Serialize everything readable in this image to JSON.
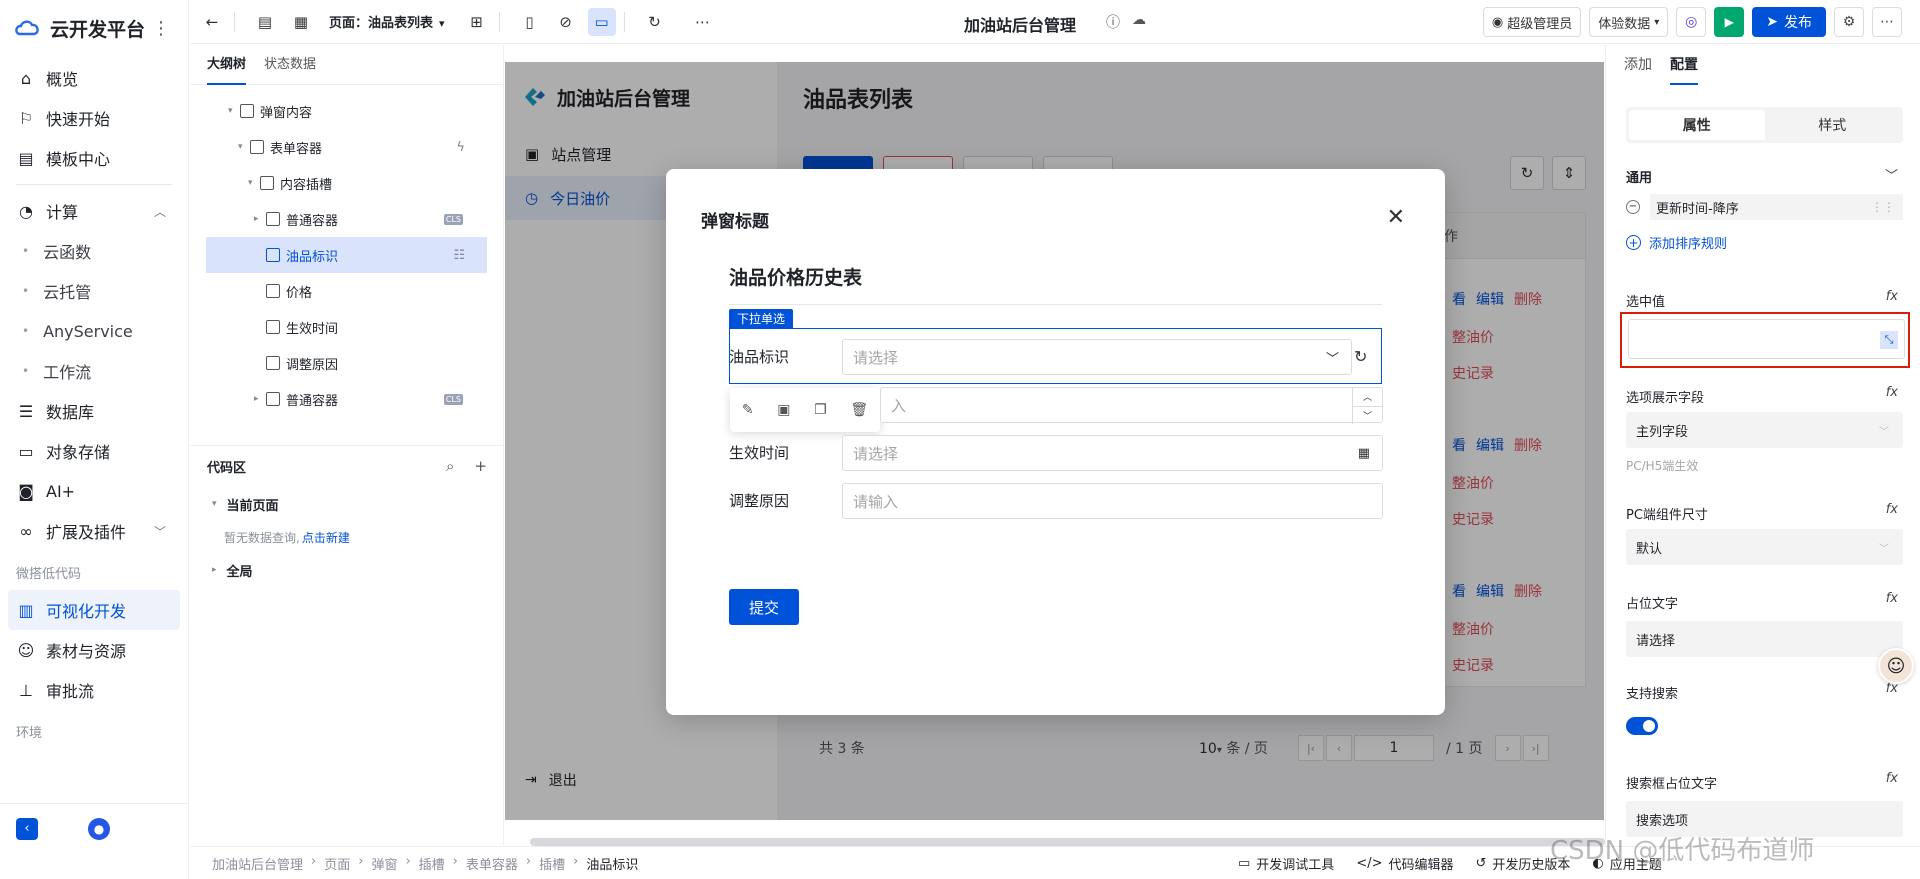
{
  "brand": {
    "title": "云开发平台"
  },
  "leftnav": {
    "items": [
      {
        "label": "概览"
      },
      {
        "label": "快速开始"
      },
      {
        "label": "模板中心"
      }
    ],
    "compute": {
      "label": "计算",
      "children": [
        "云函数",
        "云托管",
        "AnyService",
        "工作流"
      ]
    },
    "items2": [
      {
        "label": "数据库"
      },
      {
        "label": "对象存储"
      },
      {
        "label": "AI+"
      },
      {
        "label": "扩展及插件"
      }
    ],
    "group_lowcode": "微搭低代码",
    "items3": [
      {
        "label": "可视化开发"
      },
      {
        "label": "素材与资源"
      },
      {
        "label": "审批流"
      }
    ],
    "group_env": "环境"
  },
  "topbar": {
    "page_label": "页面：油品表列表",
    "app_title": "加油站后台管理",
    "role": "超级管理员",
    "data_mode": "体验数据",
    "publish": "发布"
  },
  "outline": {
    "tabs": [
      "大纲树",
      "状态数据"
    ],
    "tree": [
      {
        "label": "弹窗内容"
      },
      {
        "label": "表单容器"
      },
      {
        "label": "内容插槽"
      },
      {
        "label": "普通容器"
      },
      {
        "label": "油品标识"
      },
      {
        "label": "价格"
      },
      {
        "label": "生效时间"
      },
      {
        "label": "调整原因"
      },
      {
        "label": "普通容器"
      }
    ],
    "tag": "CLS",
    "code_area": "代码区",
    "current_page": "当前页面",
    "empty_text": "暂无数据查询,",
    "empty_link": "点击新建",
    "global": "全局"
  },
  "app": {
    "name": "加油站后台管理",
    "menus": [
      "站点管理",
      "今日油价"
    ],
    "logout": "退出",
    "page_title": "油品表列表",
    "pager": {
      "total": "共 3 条",
      "size": "10",
      "per": "条 / 页",
      "page": "1",
      "pages": "/ 1 页"
    },
    "row_ops": {
      "view": "看",
      "edit": "编辑",
      "delete": "删除",
      "adjust": "整油价",
      "history": "史记录"
    },
    "header_fragment": "作"
  },
  "modal": {
    "title": "弹窗标题",
    "form_title": "油品价格历史表",
    "badge": "下拉单选",
    "fields": [
      {
        "label": "油品标识",
        "placeholder": "请选择"
      },
      {
        "label": "",
        "placeholder": "入"
      },
      {
        "label": "生效时间",
        "placeholder": "请选择"
      },
      {
        "label": "调整原因",
        "placeholder": "请输入"
      }
    ],
    "submit": "提交"
  },
  "rpanel": {
    "tabs": [
      "添加",
      "配置"
    ],
    "seg": [
      "属性",
      "样式"
    ],
    "general": "通用",
    "sort_rule": "更新时间-降序",
    "add_rule": "添加排序规则",
    "selected_value": "选中值",
    "option_field": "选项展示字段",
    "option_field_val": "主列字段",
    "pc_h5": "PC/H5端生效",
    "pc_size": "PC端组件尺寸",
    "pc_size_val": "默认",
    "placeholder_label": "占位文字",
    "placeholder_val": "请选择",
    "search_label": "支持搜索",
    "search_ph_label": "搜索框占位文字",
    "search_ph_val": "搜索选项"
  },
  "footer": {
    "crumbs": [
      "加油站后台管理",
      "页面",
      "弹窗",
      "插槽",
      "表单容器",
      "插槽",
      "油品标识"
    ],
    "tools": [
      "开发调试工具",
      "代码编辑器",
      "开发历史版本",
      "应用主题"
    ]
  },
  "watermark": "CSDN @低代码布道师"
}
